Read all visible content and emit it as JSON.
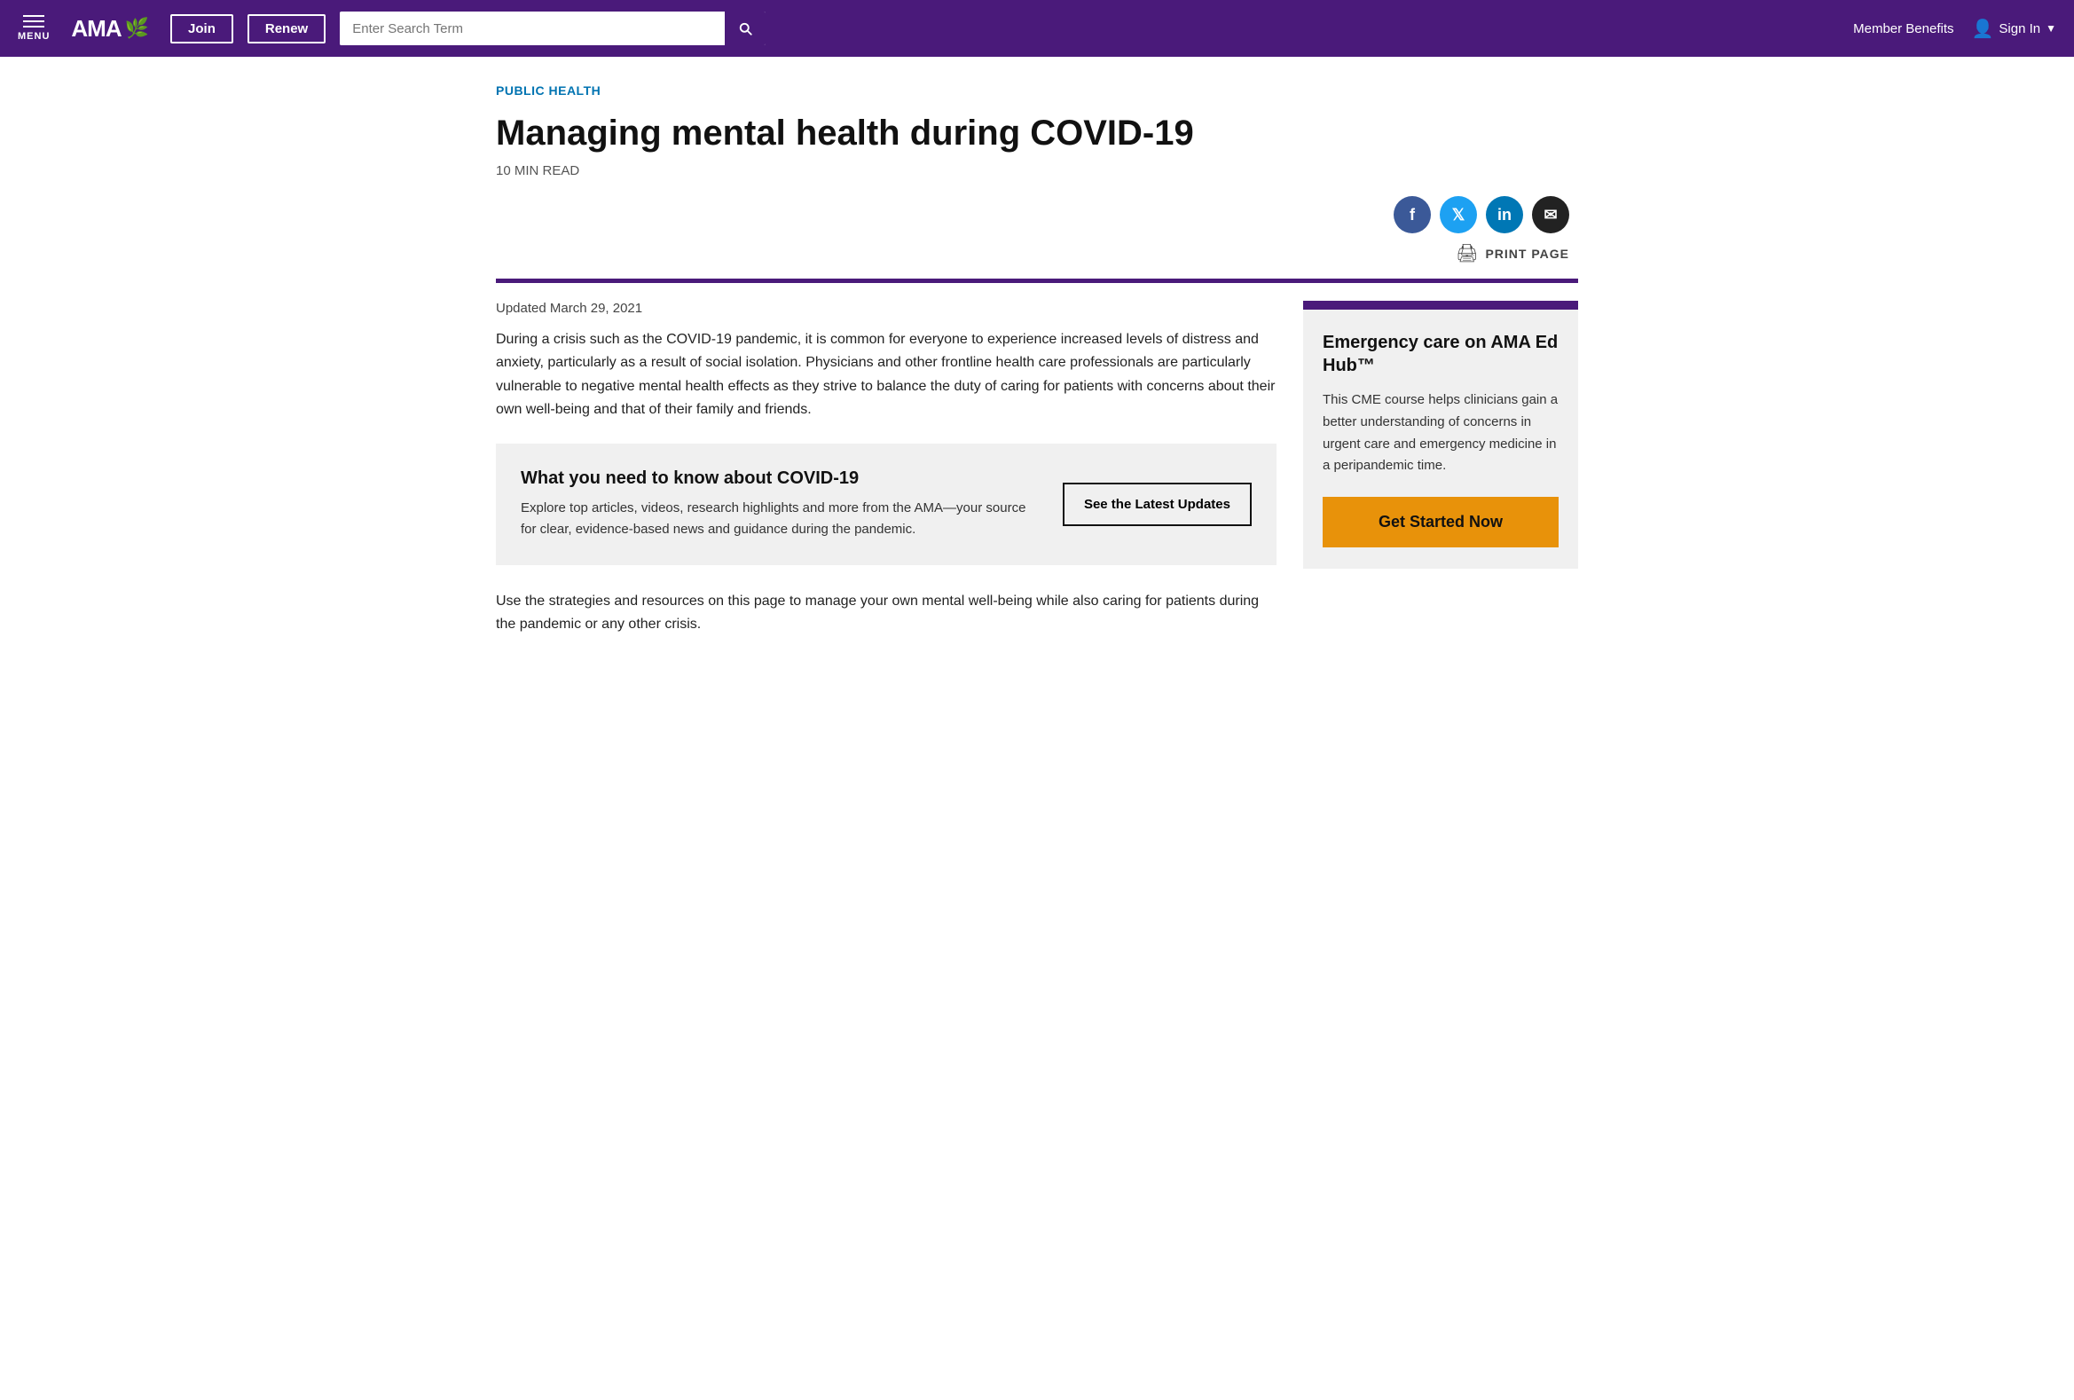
{
  "navbar": {
    "menu_label": "MENU",
    "logo_text": "AMA",
    "logo_emblem": "🌿",
    "join_label": "Join",
    "renew_label": "Renew",
    "search_placeholder": "Enter Search Term",
    "member_benefits_label": "Member Benefits",
    "sign_in_label": "Sign In"
  },
  "article": {
    "category": "PUBLIC HEALTH",
    "title": "Managing mental health during COVID-19",
    "read_time": "10 MIN READ",
    "updated_date": "Updated March 29, 2021",
    "body_paragraph": "During a crisis such as the COVID-19 pandemic, it is common for everyone to experience increased levels of distress and anxiety, particularly as a result of social isolation. Physicians and other frontline health care professionals are particularly vulnerable to negative mental health effects as they strive to balance the duty of caring for patients with concerns about their own well-being and that of their family and friends.",
    "print_label": "PRINT PAGE"
  },
  "covid_box": {
    "title": "What you need to know about COVID-19",
    "body": "Explore top articles, videos, research highlights and more from the AMA—your source for clear, evidence-based news and guidance during the pandemic.",
    "button_label": "See the Latest Updates"
  },
  "sidebar": {
    "title": "Emergency care on AMA Ed Hub™",
    "body": "This CME course helps clinicians gain a better understanding of concerns in urgent care and emergency medicine in a peripandemic time.",
    "cta_label": "Get Started Now"
  },
  "bottom_text": "Use the strategies and resources on this page to manage your own mental well-being while also caring for patients during the pandemic or any other crisis.",
  "social": {
    "facebook": "f",
    "twitter": "t",
    "linkedin": "in",
    "email": "✉"
  }
}
